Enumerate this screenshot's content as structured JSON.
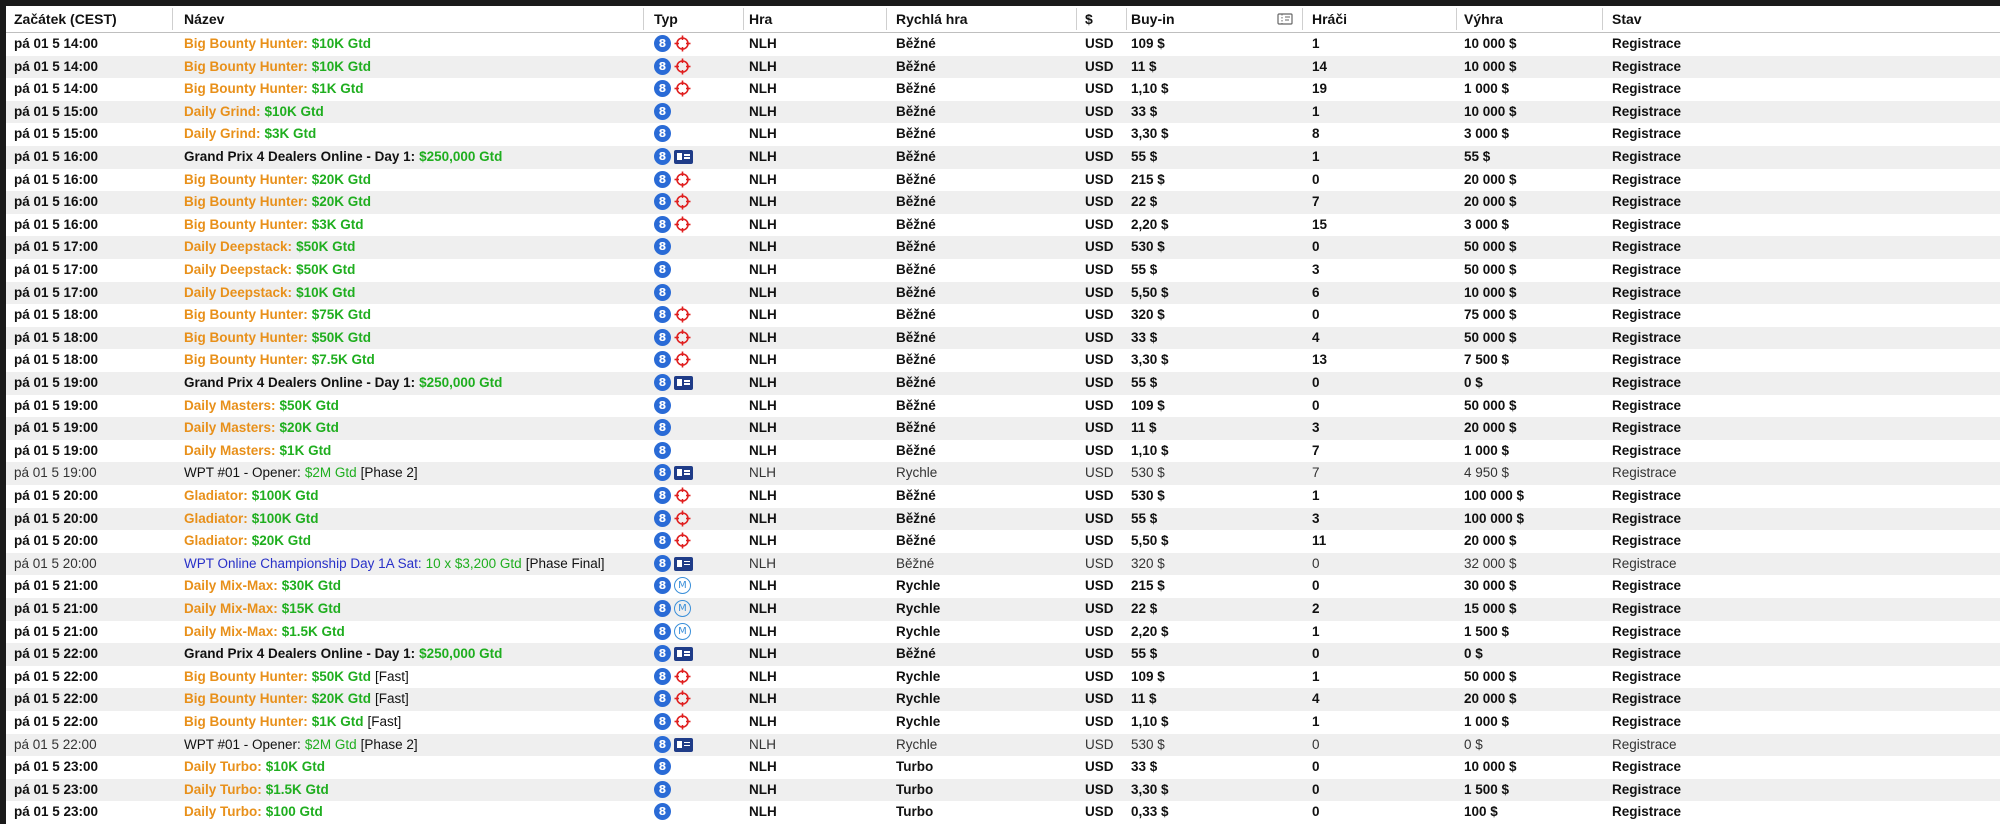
{
  "header": {
    "start": "Začátek (CEST)",
    "name": "Název",
    "type": "Typ",
    "game": "Hra",
    "speed": "Rychlá hra",
    "currency": "$",
    "buyin": "Buy-in",
    "tickets_icon": "ticket-icon",
    "players": "Hráči",
    "prize": "Výhra",
    "status": "Stav"
  },
  "colors": {
    "orange": "#e8901a",
    "green": "#1fae1f",
    "blue": "#2830c8",
    "black": "#111111",
    "badge_blue": "#2a6bd6",
    "bounty_red": "#e02020",
    "card_navy": "#1f3c88"
  },
  "rows": [
    {
      "start": "pá 01 5 14:00",
      "name_prefix": "Big Bounty Hunter:",
      "name_prize": "$10K Gtd",
      "name_suffix": "",
      "prefix_color": "orange",
      "icons": [
        "eight",
        "bounty"
      ],
      "game": "NLH",
      "speed": "Běžné",
      "currency": "USD",
      "buyin": "109 $",
      "players": "1",
      "prize": "10 000 $",
      "status": "Registrace",
      "light": false
    },
    {
      "start": "pá 01 5 14:00",
      "name_prefix": "Big Bounty Hunter:",
      "name_prize": "$10K Gtd",
      "name_suffix": "",
      "prefix_color": "orange",
      "icons": [
        "eight",
        "bounty"
      ],
      "game": "NLH",
      "speed": "Běžné",
      "currency": "USD",
      "buyin": "11 $",
      "players": "14",
      "prize": "10 000 $",
      "status": "Registrace",
      "light": false
    },
    {
      "start": "pá 01 5 14:00",
      "name_prefix": "Big Bounty Hunter:",
      "name_prize": "$1K Gtd",
      "name_suffix": "",
      "prefix_color": "orange",
      "icons": [
        "eight",
        "bounty"
      ],
      "game": "NLH",
      "speed": "Běžné",
      "currency": "USD",
      "buyin": "1,10 $",
      "players": "19",
      "prize": "1 000 $",
      "status": "Registrace",
      "light": false
    },
    {
      "start": "pá 01 5 15:00",
      "name_prefix": "Daily Grind:",
      "name_prize": "$10K Gtd",
      "name_suffix": "",
      "prefix_color": "orange",
      "icons": [
        "eight"
      ],
      "game": "NLH",
      "speed": "Běžné",
      "currency": "USD",
      "buyin": "33 $",
      "players": "1",
      "prize": "10 000 $",
      "status": "Registrace",
      "light": false
    },
    {
      "start": "pá 01 5 15:00",
      "name_prefix": "Daily Grind:",
      "name_prize": "$3K Gtd",
      "name_suffix": "",
      "prefix_color": "orange",
      "icons": [
        "eight"
      ],
      "game": "NLH",
      "speed": "Běžné",
      "currency": "USD",
      "buyin": "3,30 $",
      "players": "8",
      "prize": "3 000 $",
      "status": "Registrace",
      "light": false
    },
    {
      "start": "pá 01 5 16:00",
      "name_prefix": "Grand Prix 4 Dealers Online - Day 1:",
      "name_prize": "$250,000 Gtd",
      "name_suffix": "",
      "prefix_color": "black",
      "icons": [
        "eight",
        "card"
      ],
      "game": "NLH",
      "speed": "Běžné",
      "currency": "USD",
      "buyin": "55 $",
      "players": "1",
      "prize": "55 $",
      "status": "Registrace",
      "light": false
    },
    {
      "start": "pá 01 5 16:00",
      "name_prefix": "Big Bounty Hunter:",
      "name_prize": "$20K Gtd",
      "name_suffix": "",
      "prefix_color": "orange",
      "icons": [
        "eight",
        "bounty"
      ],
      "game": "NLH",
      "speed": "Běžné",
      "currency": "USD",
      "buyin": "215 $",
      "players": "0",
      "prize": "20 000 $",
      "status": "Registrace",
      "light": false
    },
    {
      "start": "pá 01 5 16:00",
      "name_prefix": "Big Bounty Hunter:",
      "name_prize": "$20K Gtd",
      "name_suffix": "",
      "prefix_color": "orange",
      "icons": [
        "eight",
        "bounty"
      ],
      "game": "NLH",
      "speed": "Běžné",
      "currency": "USD",
      "buyin": "22 $",
      "players": "7",
      "prize": "20 000 $",
      "status": "Registrace",
      "light": false
    },
    {
      "start": "pá 01 5 16:00",
      "name_prefix": "Big Bounty Hunter:",
      "name_prize": "$3K Gtd",
      "name_suffix": "",
      "prefix_color": "orange",
      "icons": [
        "eight",
        "bounty"
      ],
      "game": "NLH",
      "speed": "Běžné",
      "currency": "USD",
      "buyin": "2,20 $",
      "players": "15",
      "prize": "3 000 $",
      "status": "Registrace",
      "light": false
    },
    {
      "start": "pá 01 5 17:00",
      "name_prefix": "Daily Deepstack:",
      "name_prize": "$50K Gtd",
      "name_suffix": "",
      "prefix_color": "orange",
      "icons": [
        "eight"
      ],
      "game": "NLH",
      "speed": "Běžné",
      "currency": "USD",
      "buyin": "530 $",
      "players": "0",
      "prize": "50 000 $",
      "status": "Registrace",
      "light": false
    },
    {
      "start": "pá 01 5 17:00",
      "name_prefix": "Daily Deepstack:",
      "name_prize": "$50K Gtd",
      "name_suffix": "",
      "prefix_color": "orange",
      "icons": [
        "eight"
      ],
      "game": "NLH",
      "speed": "Běžné",
      "currency": "USD",
      "buyin": "55 $",
      "players": "3",
      "prize": "50 000 $",
      "status": "Registrace",
      "light": false
    },
    {
      "start": "pá 01 5 17:00",
      "name_prefix": "Daily Deepstack:",
      "name_prize": "$10K Gtd",
      "name_suffix": "",
      "prefix_color": "orange",
      "icons": [
        "eight"
      ],
      "game": "NLH",
      "speed": "Běžné",
      "currency": "USD",
      "buyin": "5,50 $",
      "players": "6",
      "prize": "10 000 $",
      "status": "Registrace",
      "light": false
    },
    {
      "start": "pá 01 5 18:00",
      "name_prefix": "Big Bounty Hunter:",
      "name_prize": "$75K Gtd",
      "name_suffix": "",
      "prefix_color": "orange",
      "icons": [
        "eight",
        "bounty"
      ],
      "game": "NLH",
      "speed": "Běžné",
      "currency": "USD",
      "buyin": "320 $",
      "players": "0",
      "prize": "75 000 $",
      "status": "Registrace",
      "light": false
    },
    {
      "start": "pá 01 5 18:00",
      "name_prefix": "Big Bounty Hunter:",
      "name_prize": "$50K Gtd",
      "name_suffix": "",
      "prefix_color": "orange",
      "icons": [
        "eight",
        "bounty"
      ],
      "game": "NLH",
      "speed": "Běžné",
      "currency": "USD",
      "buyin": "33 $",
      "players": "4",
      "prize": "50 000 $",
      "status": "Registrace",
      "light": false
    },
    {
      "start": "pá 01 5 18:00",
      "name_prefix": "Big Bounty Hunter:",
      "name_prize": "$7.5K Gtd",
      "name_suffix": "",
      "prefix_color": "orange",
      "icons": [
        "eight",
        "bounty"
      ],
      "game": "NLH",
      "speed": "Běžné",
      "currency": "USD",
      "buyin": "3,30 $",
      "players": "13",
      "prize": "7 500 $",
      "status": "Registrace",
      "light": false
    },
    {
      "start": "pá 01 5 19:00",
      "name_prefix": "Grand Prix 4 Dealers Online - Day 1:",
      "name_prize": "$250,000 Gtd",
      "name_suffix": "",
      "prefix_color": "black",
      "icons": [
        "eight",
        "card"
      ],
      "game": "NLH",
      "speed": "Běžné",
      "currency": "USD",
      "buyin": "55 $",
      "players": "0",
      "prize": "0 $",
      "status": "Registrace",
      "light": false
    },
    {
      "start": "pá 01 5 19:00",
      "name_prefix": "Daily Masters:",
      "name_prize": "$50K Gtd",
      "name_suffix": "",
      "prefix_color": "orange",
      "icons": [
        "eight"
      ],
      "game": "NLH",
      "speed": "Běžné",
      "currency": "USD",
      "buyin": "109 $",
      "players": "0",
      "prize": "50 000 $",
      "status": "Registrace",
      "light": false
    },
    {
      "start": "pá 01 5 19:00",
      "name_prefix": "Daily Masters:",
      "name_prize": "$20K Gtd",
      "name_suffix": "",
      "prefix_color": "orange",
      "icons": [
        "eight"
      ],
      "game": "NLH",
      "speed": "Běžné",
      "currency": "USD",
      "buyin": "11 $",
      "players": "3",
      "prize": "20 000 $",
      "status": "Registrace",
      "light": false
    },
    {
      "start": "pá 01 5 19:00",
      "name_prefix": "Daily Masters:",
      "name_prize": "$1K Gtd",
      "name_suffix": "",
      "prefix_color": "orange",
      "icons": [
        "eight"
      ],
      "game": "NLH",
      "speed": "Běžné",
      "currency": "USD",
      "buyin": "1,10 $",
      "players": "7",
      "prize": "1 000 $",
      "status": "Registrace",
      "light": false
    },
    {
      "start": "pá 01 5 19:00",
      "name_prefix": "WPT #01 - Opener:",
      "name_prize": "$2M Gtd",
      "name_suffix": "[Phase 2]",
      "prefix_color": "black",
      "icons": [
        "eight",
        "card"
      ],
      "game": "NLH",
      "speed": "Rychle",
      "currency": "USD",
      "buyin": "530 $",
      "players": "7",
      "prize": "4 950 $",
      "status": "Registrace",
      "light": true
    },
    {
      "start": "pá 01 5 20:00",
      "name_prefix": "Gladiator:",
      "name_prize": "$100K Gtd",
      "name_suffix": "",
      "prefix_color": "orange",
      "icons": [
        "eight",
        "bounty"
      ],
      "game": "NLH",
      "speed": "Běžné",
      "currency": "USD",
      "buyin": "530 $",
      "players": "1",
      "prize": "100 000 $",
      "status": "Registrace",
      "light": false
    },
    {
      "start": "pá 01 5 20:00",
      "name_prefix": "Gladiator:",
      "name_prize": "$100K Gtd",
      "name_suffix": "",
      "prefix_color": "orange",
      "icons": [
        "eight",
        "bounty"
      ],
      "game": "NLH",
      "speed": "Běžné",
      "currency": "USD",
      "buyin": "55 $",
      "players": "3",
      "prize": "100 000 $",
      "status": "Registrace",
      "light": false
    },
    {
      "start": "pá 01 5 20:00",
      "name_prefix": "Gladiator:",
      "name_prize": "$20K Gtd",
      "name_suffix": "",
      "prefix_color": "orange",
      "icons": [
        "eight",
        "bounty"
      ],
      "game": "NLH",
      "speed": "Běžné",
      "currency": "USD",
      "buyin": "5,50 $",
      "players": "11",
      "prize": "20 000 $",
      "status": "Registrace",
      "light": false
    },
    {
      "start": "pá 01 5 20:00",
      "name_prefix": "WPT Online Championship Day 1A Sat:",
      "name_prize": "10 x $3,200 Gtd",
      "name_suffix": "[Phase Final]",
      "prefix_color": "blue",
      "icons": [
        "eight",
        "card"
      ],
      "game": "NLH",
      "speed": "Běžné",
      "currency": "USD",
      "buyin": "320 $",
      "players": "0",
      "prize": "32 000 $",
      "status": "Registrace",
      "light": true
    },
    {
      "start": "pá 01 5 21:00",
      "name_prefix": "Daily Mix-Max:",
      "name_prize": "$30K Gtd",
      "name_suffix": "",
      "prefix_color": "orange",
      "icons": [
        "eight",
        "mixmax"
      ],
      "game": "NLH",
      "speed": "Rychle",
      "currency": "USD",
      "buyin": "215 $",
      "players": "0",
      "prize": "30 000 $",
      "status": "Registrace",
      "light": false
    },
    {
      "start": "pá 01 5 21:00",
      "name_prefix": "Daily Mix-Max:",
      "name_prize": "$15K Gtd",
      "name_suffix": "",
      "prefix_color": "orange",
      "icons": [
        "eight",
        "mixmax"
      ],
      "game": "NLH",
      "speed": "Rychle",
      "currency": "USD",
      "buyin": "22 $",
      "players": "2",
      "prize": "15 000 $",
      "status": "Registrace",
      "light": false
    },
    {
      "start": "pá 01 5 21:00",
      "name_prefix": "Daily Mix-Max:",
      "name_prize": "$1.5K Gtd",
      "name_suffix": "",
      "prefix_color": "orange",
      "icons": [
        "eight",
        "mixmax"
      ],
      "game": "NLH",
      "speed": "Rychle",
      "currency": "USD",
      "buyin": "2,20 $",
      "players": "1",
      "prize": "1 500 $",
      "status": "Registrace",
      "light": false
    },
    {
      "start": "pá 01 5 22:00",
      "name_prefix": "Grand Prix 4 Dealers Online - Day 1:",
      "name_prize": "$250,000 Gtd",
      "name_suffix": "",
      "prefix_color": "black",
      "icons": [
        "eight",
        "card"
      ],
      "game": "NLH",
      "speed": "Běžné",
      "currency": "USD",
      "buyin": "55 $",
      "players": "0",
      "prize": "0 $",
      "status": "Registrace",
      "light": false
    },
    {
      "start": "pá 01 5 22:00",
      "name_prefix": "Big Bounty Hunter:",
      "name_prize": "$50K Gtd",
      "name_suffix": "[Fast]",
      "prefix_color": "orange",
      "icons": [
        "eight",
        "bounty"
      ],
      "game": "NLH",
      "speed": "Rychle",
      "currency": "USD",
      "buyin": "109 $",
      "players": "1",
      "prize": "50 000 $",
      "status": "Registrace",
      "light": false
    },
    {
      "start": "pá 01 5 22:00",
      "name_prefix": "Big Bounty Hunter:",
      "name_prize": "$20K Gtd",
      "name_suffix": "[Fast]",
      "prefix_color": "orange",
      "icons": [
        "eight",
        "bounty"
      ],
      "game": "NLH",
      "speed": "Rychle",
      "currency": "USD",
      "buyin": "11 $",
      "players": "4",
      "prize": "20 000 $",
      "status": "Registrace",
      "light": false
    },
    {
      "start": "pá 01 5 22:00",
      "name_prefix": "Big Bounty Hunter:",
      "name_prize": "$1K Gtd",
      "name_suffix": "[Fast]",
      "prefix_color": "orange",
      "icons": [
        "eight",
        "bounty"
      ],
      "game": "NLH",
      "speed": "Rychle",
      "currency": "USD",
      "buyin": "1,10 $",
      "players": "1",
      "prize": "1 000 $",
      "status": "Registrace",
      "light": false
    },
    {
      "start": "pá 01 5 22:00",
      "name_prefix": "WPT #01 - Opener:",
      "name_prize": "$2M Gtd",
      "name_suffix": "[Phase 2]",
      "prefix_color": "black",
      "icons": [
        "eight",
        "card"
      ],
      "game": "NLH",
      "speed": "Rychle",
      "currency": "USD",
      "buyin": "530 $",
      "players": "0",
      "prize": "0 $",
      "status": "Registrace",
      "light": true
    },
    {
      "start": "pá 01 5 23:00",
      "name_prefix": "Daily Turbo:",
      "name_prize": "$10K Gtd",
      "name_suffix": "",
      "prefix_color": "orange",
      "icons": [
        "eight"
      ],
      "game": "NLH",
      "speed": "Turbo",
      "currency": "USD",
      "buyin": "33 $",
      "players": "0",
      "prize": "10 000 $",
      "status": "Registrace",
      "light": false
    },
    {
      "start": "pá 01 5 23:00",
      "name_prefix": "Daily Turbo:",
      "name_prize": "$1.5K Gtd",
      "name_suffix": "",
      "prefix_color": "orange",
      "icons": [
        "eight"
      ],
      "game": "NLH",
      "speed": "Turbo",
      "currency": "USD",
      "buyin": "3,30 $",
      "players": "0",
      "prize": "1 500 $",
      "status": "Registrace",
      "light": false
    },
    {
      "start": "pá 01 5 23:00",
      "name_prefix": "Daily Turbo:",
      "name_prize": "$100 Gtd",
      "name_suffix": "",
      "prefix_color": "orange",
      "icons": [
        "eight"
      ],
      "game": "NLH",
      "speed": "Turbo",
      "currency": "USD",
      "buyin": "0,33 $",
      "players": "0",
      "prize": "100 $",
      "status": "Registrace",
      "light": false
    }
  ]
}
